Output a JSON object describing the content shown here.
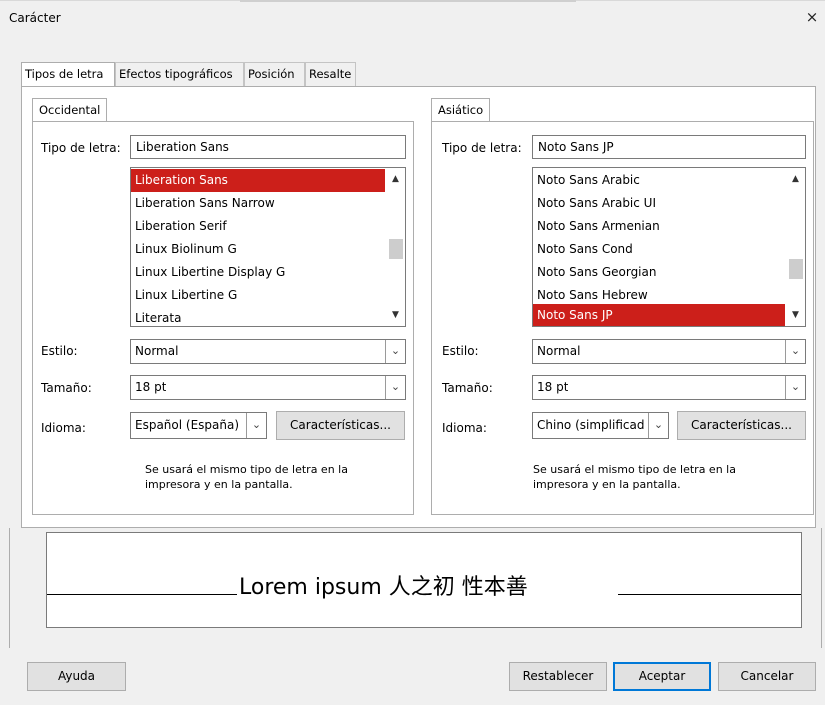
{
  "window": {
    "title": "Carácter",
    "close_icon": "×"
  },
  "tabs": [
    "Tipos de letra",
    "Efectos tipográficos",
    "Posición",
    "Resalte"
  ],
  "western": {
    "tab": "Occidental",
    "font_label": "Tipo de letra:",
    "font_value": "Liberation Sans",
    "font_list": [
      "Liberation Sans",
      "Liberation Sans Narrow",
      "Liberation Serif",
      "Linux Biolinum G",
      "Linux Libertine Display G",
      "Linux Libertine G",
      "Literata"
    ],
    "selected_index": 0,
    "style_label": "Estilo:",
    "style_value": "Normal",
    "size_label": "Tamaño:",
    "size_value": "18 pt",
    "language_label": "Idioma:",
    "language_value": "Español (España)",
    "features_button": "Características...",
    "note": "Se usará el mismo tipo de letra en la impresora y en la pantalla."
  },
  "asian": {
    "tab": "Asiático",
    "font_label": "Tipo de letra:",
    "font_value": "Noto Sans JP",
    "font_list": [
      "Noto Sans Arabic",
      "Noto Sans Arabic UI",
      "Noto Sans Armenian",
      "Noto Sans Cond",
      "Noto Sans Georgian",
      "Noto Sans Hebrew",
      "Noto Sans JP"
    ],
    "selected_index": 6,
    "style_label": "Estilo:",
    "style_value": "Normal",
    "size_label": "Tamaño:",
    "size_value": "18 pt",
    "language_label": "Idioma:",
    "language_value": "Chino (simplificado)",
    "features_button": "Características...",
    "note": "Se usará el mismo tipo de letra en la impresora y en la pantalla."
  },
  "preview": {
    "text": "Lorem ipsum   人之初 性本善"
  },
  "buttons": {
    "help": "Ayuda",
    "reset": "Restablecer",
    "ok": "Aceptar",
    "cancel": "Cancelar"
  },
  "colors": {
    "selection": "#cc1f1a",
    "default_button_border": "#0078d7"
  }
}
